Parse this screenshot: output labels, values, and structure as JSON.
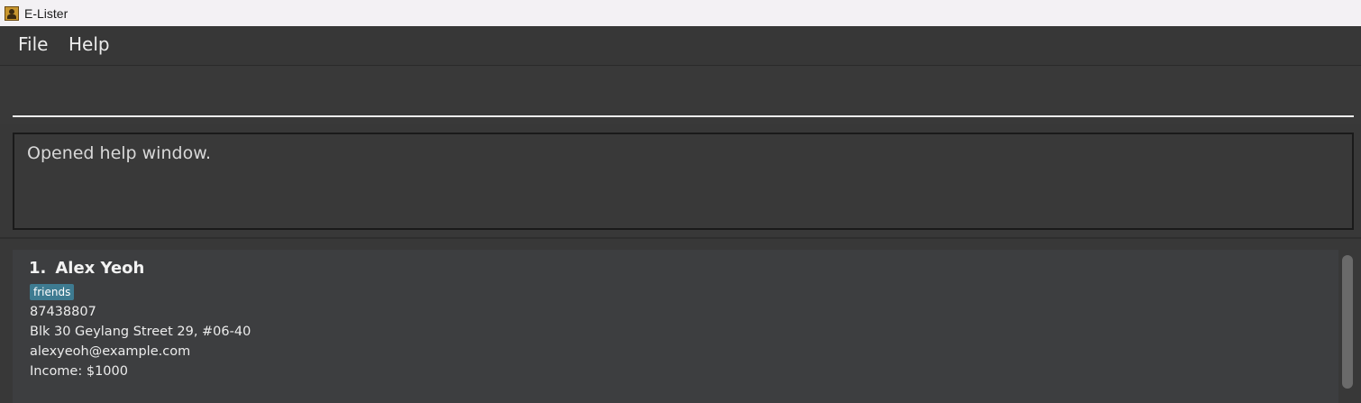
{
  "window": {
    "title": "E-Lister",
    "icon": "app-person-icon"
  },
  "menubar": {
    "items": [
      {
        "label": "File"
      },
      {
        "label": "Help"
      }
    ]
  },
  "command": {
    "value": "",
    "placeholder": ""
  },
  "result": {
    "message": "Opened help window."
  },
  "persons": [
    {
      "index": "1.",
      "name": "Alex Yeoh",
      "tags": [
        "friends"
      ],
      "phone": "87438807",
      "address": "Blk 30 Geylang Street 29, #06-40",
      "email": "alexyeoh@example.com",
      "income": "Income: $1000"
    }
  ],
  "colors": {
    "background": "#383838",
    "card": "#3d3e40",
    "tag": "#3e7b91",
    "titlebar": "#f3f1f4"
  }
}
